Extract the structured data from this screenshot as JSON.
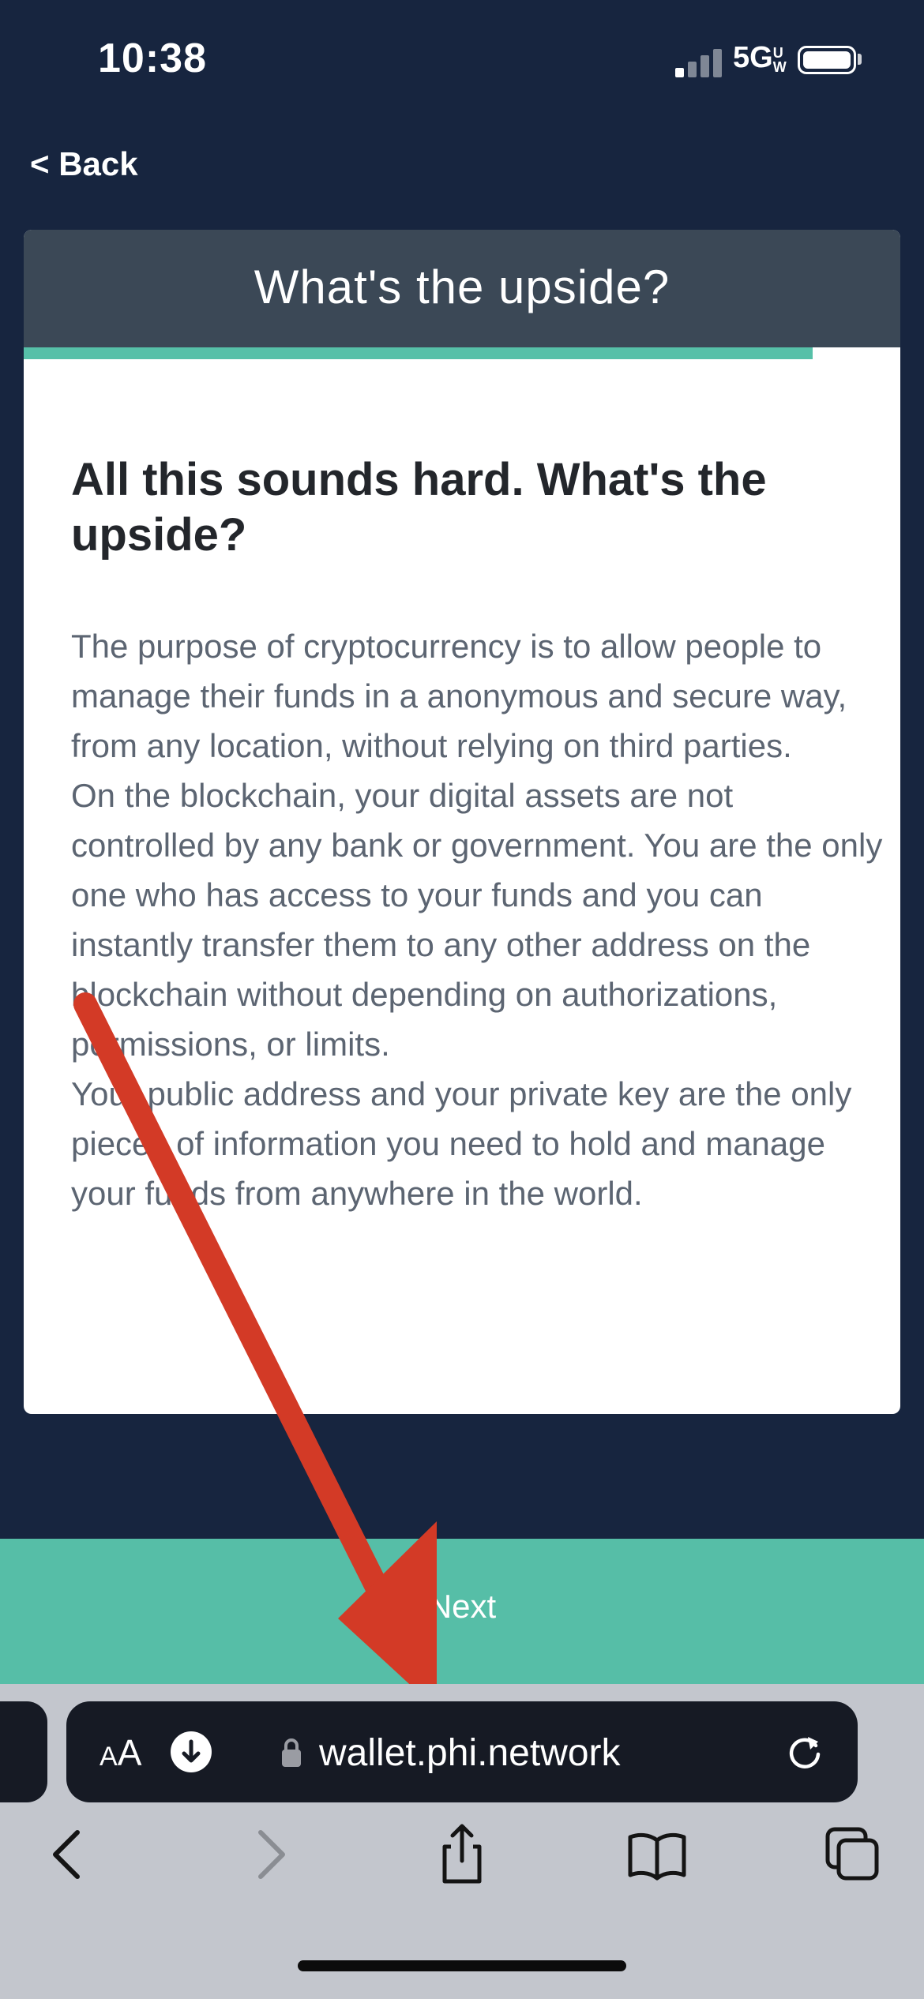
{
  "status_bar": {
    "time": "10:38",
    "network": "5G",
    "network_sub": "UW"
  },
  "nav": {
    "back_label": "< Back"
  },
  "card": {
    "title": "What's the upside?",
    "progress": 0.9,
    "heading": "All this sounds hard. What's the upside?",
    "paragraphs": [
      "The purpose of cryptocurrency is to allow people to manage their funds in a anonymous and secure way, from any location, without relying on third parties.",
      "On the blockchain, your digital assets are not controlled by any bank or government. You are the only one who has access to your funds and you can instantly transfer them to any other address on the blockchain without depending on authorizations, permissions, or limits.",
      "Your public address and your private key are the only pieces of information you need to hold and manage your funds from anywhere in the world."
    ]
  },
  "next_button": {
    "label": "Next"
  },
  "browser": {
    "aa_big": "A",
    "aa_small": "A",
    "url": "wallet.phi.network"
  },
  "colors": {
    "background": "#17253f",
    "card_header": "#3b4856",
    "accent": "#56bea7",
    "annotation_arrow": "#d33a26"
  }
}
